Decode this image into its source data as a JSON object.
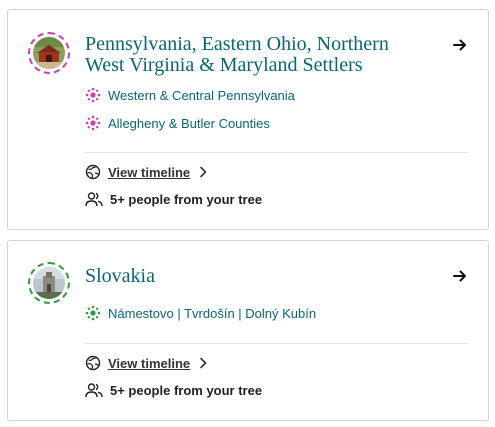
{
  "cards": [
    {
      "title": "Pennsylvania, Eastern Ohio, Northern West Virginia & Maryland Settlers",
      "ring_color": "#d63aaf",
      "regions": [
        "Western & Central Pennsylvania",
        "Allegheny & Butler Counties"
      ],
      "timeline_label": "View timeline",
      "people_label": "5+ people from your tree"
    },
    {
      "title": "Slovakia",
      "ring_color": "#2f9c3a",
      "regions": [
        "Námestovo | Tvrdošín | Dolný Kubín"
      ],
      "timeline_label": "View timeline",
      "people_label": "5+ people from your tree"
    }
  ],
  "icons": {
    "region": "community-dots-icon",
    "timeline": "globe-icon",
    "people": "people-icon",
    "navigate": "arrow-right-icon",
    "chevron": "chevron-right-icon"
  }
}
